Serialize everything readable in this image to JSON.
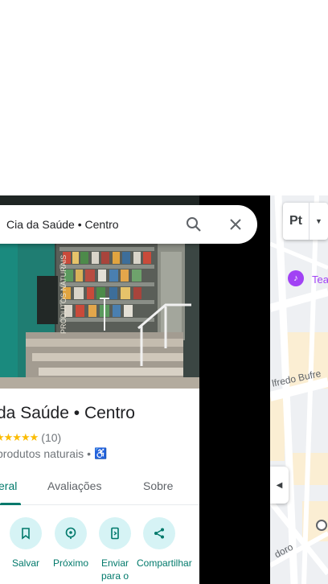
{
  "search": {
    "query": "Cia da Saúde • Centro"
  },
  "place": {
    "title": "da Saúde • Centro",
    "rating_stars": "★★★★★",
    "review_count": "(10)",
    "category": "produtos naturais •",
    "photo_sign": "PRODUTOS NATURAIS"
  },
  "tabs": [
    {
      "label": "eral",
      "active": true
    },
    {
      "label": "Avaliações",
      "active": false
    },
    {
      "label": "Sobre",
      "active": false
    }
  ],
  "actions": [
    {
      "label": "Salvar",
      "icon": "bookmark-icon"
    },
    {
      "label": "Próximo",
      "icon": "nearby-icon"
    },
    {
      "label": "Enviar para o",
      "icon": "send-to-phone-icon"
    },
    {
      "label": "Compartilhar",
      "icon": "share-icon"
    }
  ],
  "map": {
    "layers_label": "Pt",
    "street_label": "lfredo Bufre",
    "street_label_2": "doro",
    "poi_label": "Tea"
  },
  "colors": {
    "accent": "#00796b",
    "action_bg": "#d6f3f5",
    "star": "#fbbc04",
    "poi": "#a142f4"
  }
}
